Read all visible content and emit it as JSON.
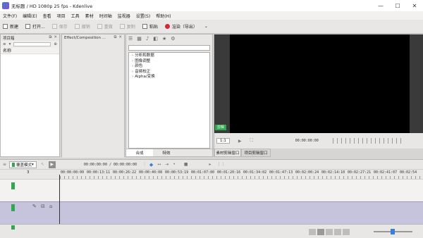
{
  "window": {
    "title": "无标题 / HD 1080p 25 fps - Kdenlive",
    "minimize": "—",
    "maximize": "☐",
    "close": "✕"
  },
  "menu": [
    "文件(F)",
    "编辑(E)",
    "查看",
    "项目",
    "工具",
    "素材",
    "时间轴",
    "监视器",
    "设置(S)",
    "帮助(H)"
  ],
  "toolbar": {
    "new": "新建",
    "open": "打开...",
    "save": "保存",
    "undo": "撤销",
    "redo": "重做",
    "copy": "复制",
    "paste": "粘贴",
    "render": "渲染（导出）",
    "more": "⌄"
  },
  "project_bin": {
    "title": "项目箱",
    "column": "名称"
  },
  "effects_panel": {
    "title": "Effect/Composition ...",
    "search_placeholder": "",
    "categories": [
      "分析和数据",
      "图像调整",
      "颜色",
      "音频校正",
      "Alpha/变换"
    ],
    "tabs": [
      "合成",
      "特效"
    ]
  },
  "monitor": {
    "zoom": "1:1",
    "timecode": "00:00:00:00",
    "tabs": [
      "素材剪辑窗口",
      "项目剪辑窗口"
    ],
    "marker": "剪辑"
  },
  "timeline": {
    "mode": "覆盖模式",
    "position": "00:00:00:00",
    "duration": "00:00:00:00",
    "separator": "/",
    "track_num": "3",
    "ruler": [
      "00:00:00:00",
      "00:00:13:11",
      "00:00:26:22",
      "00:00:40:08",
      "00:00:53:19",
      "00:01:07:00",
      "00:01:20:16",
      "00:01:34:02",
      "00:01:47:13",
      "00:02:00:24",
      "00:02:14:10",
      "00:02:27:21",
      "00:02:41:07",
      "00:02:54"
    ]
  },
  "colors": {
    "accent_green": "#2fa84f",
    "record_red": "#d6263b",
    "video_track": "#c6c4dc"
  }
}
